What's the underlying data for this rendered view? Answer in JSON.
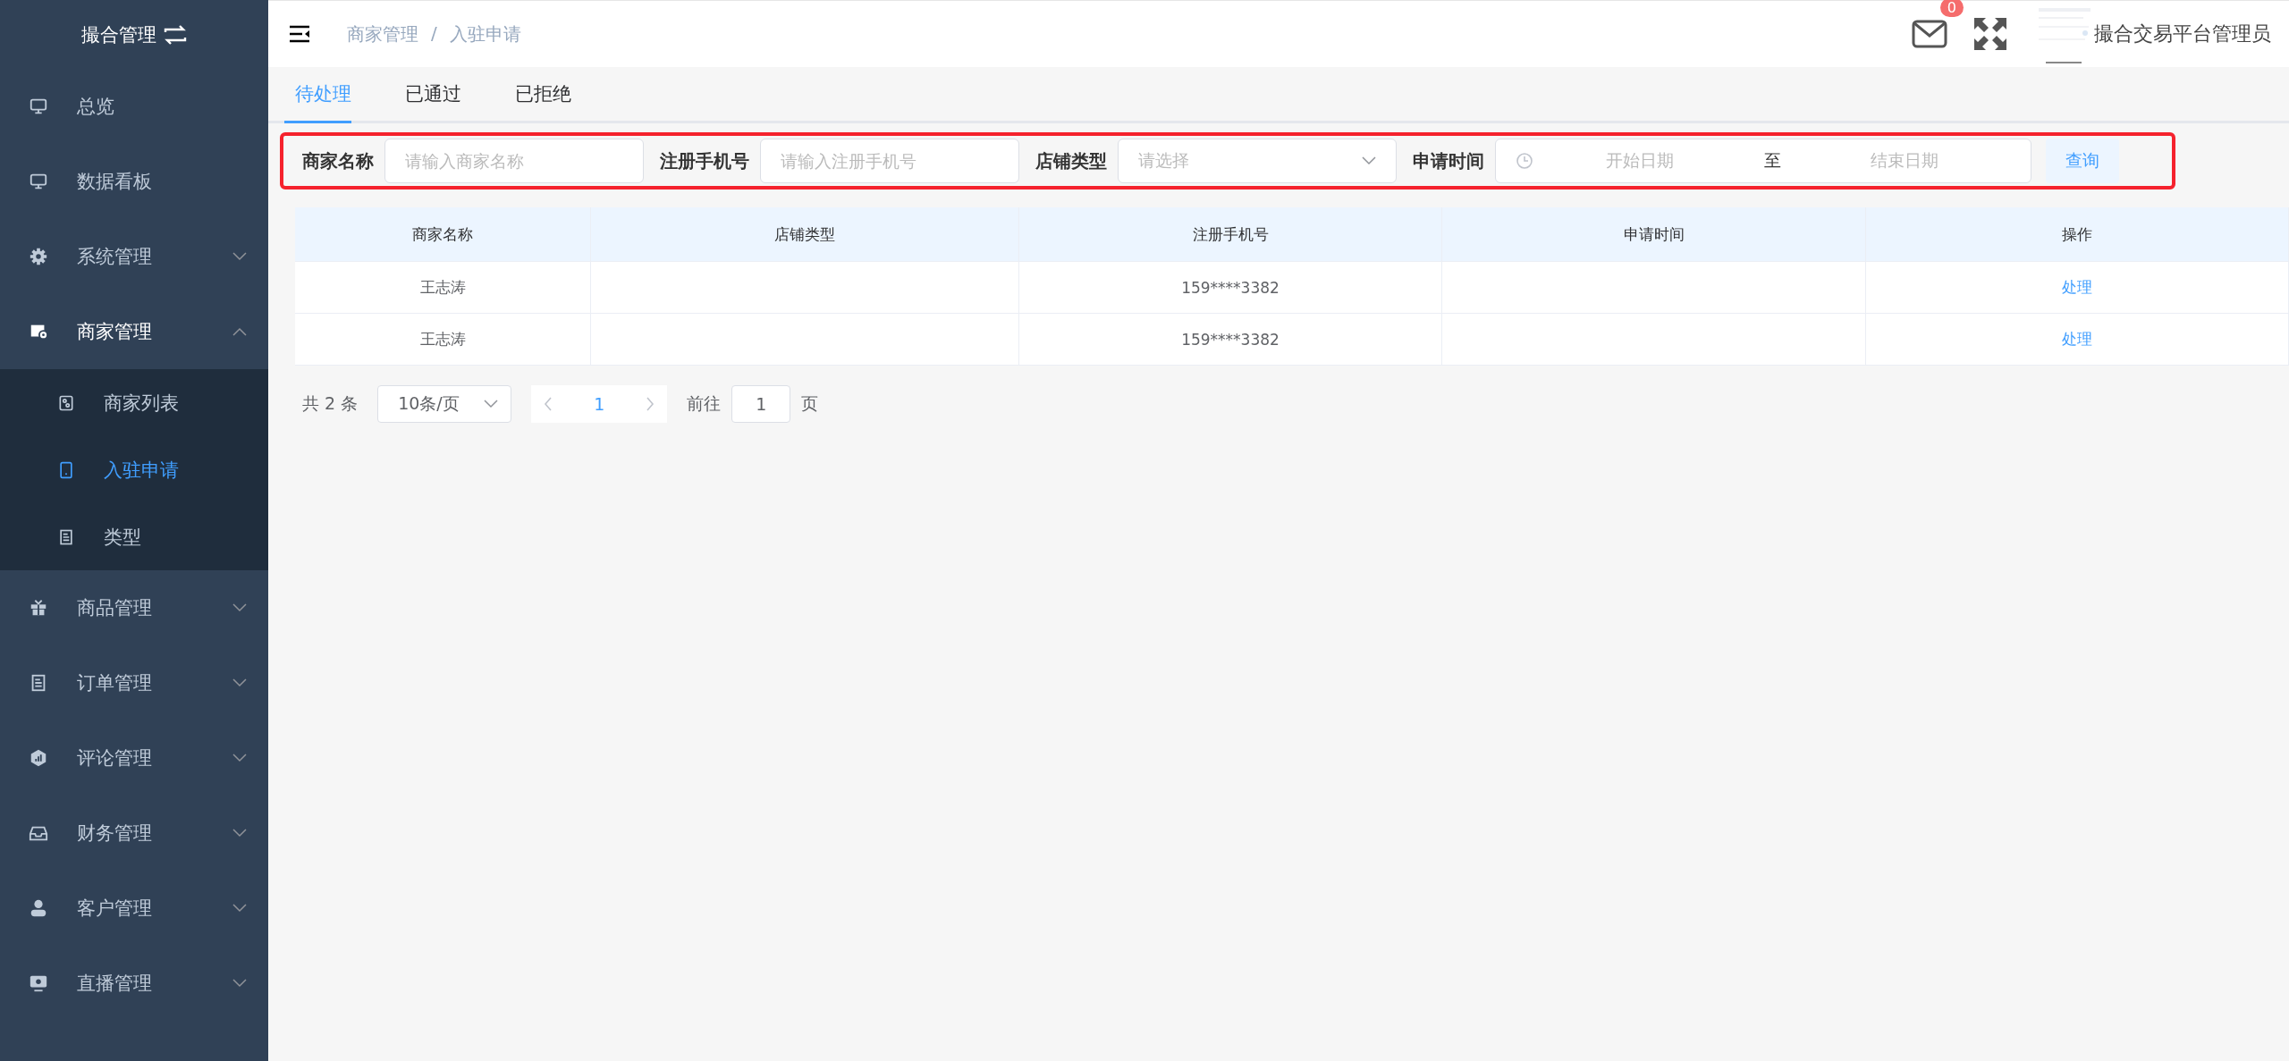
{
  "sidebar": {
    "title": "撮合管理",
    "items": [
      {
        "label": "总览"
      },
      {
        "label": "数据看板"
      },
      {
        "label": "系统管理",
        "expanded": false
      },
      {
        "label": "商家管理",
        "expanded": true,
        "children": [
          {
            "label": "商家列表",
            "selected": false
          },
          {
            "label": "入驻申请",
            "selected": true
          },
          {
            "label": "类型",
            "selected": false
          }
        ]
      },
      {
        "label": "商品管理",
        "expanded": false
      },
      {
        "label": "订单管理",
        "expanded": false
      },
      {
        "label": "评论管理",
        "expanded": false
      },
      {
        "label": "财务管理",
        "expanded": false
      },
      {
        "label": "客户管理",
        "expanded": false
      },
      {
        "label": "直播管理",
        "expanded": false
      }
    ]
  },
  "header": {
    "breadcrumb": [
      "商家管理",
      "入驻申请"
    ],
    "separator": "/",
    "mail_badge": "0",
    "user_name": "撮合交易平台管理员"
  },
  "tabs": [
    {
      "label": "待处理",
      "selected": true
    },
    {
      "label": "已通过",
      "selected": false
    },
    {
      "label": "已拒绝",
      "selected": false
    }
  ],
  "filters": {
    "highlighted": true,
    "fields": [
      {
        "kind": "input",
        "label": "商家名称",
        "placeholder": "请输入商家名称"
      },
      {
        "kind": "input",
        "label": "注册手机号",
        "placeholder": "请输入注册手机号"
      },
      {
        "kind": "select",
        "label": "店铺类型",
        "placeholder": "请选择"
      },
      {
        "kind": "daterange",
        "label": "申请时间",
        "start_placeholder": "开始日期",
        "separator": "至",
        "end_placeholder": "结束日期"
      }
    ],
    "query_button": "查询"
  },
  "table": {
    "columns": [
      "商家名称",
      "店铺类型",
      "注册手机号",
      "申请时间",
      "操作"
    ],
    "rows": [
      {
        "merchant_name": "王志涛",
        "phone": "159****3382",
        "action": "处理"
      },
      {
        "merchant_name": "王志涛",
        "phone": "159****3382",
        "action": "处理"
      }
    ]
  },
  "pagination": {
    "total": "共 2 条",
    "page_size": "10条/页",
    "pages": [
      {
        "label": "1",
        "selected": true
      }
    ],
    "goto_label": "前往",
    "goto_value": "1",
    "goto_suffix": "页"
  }
}
